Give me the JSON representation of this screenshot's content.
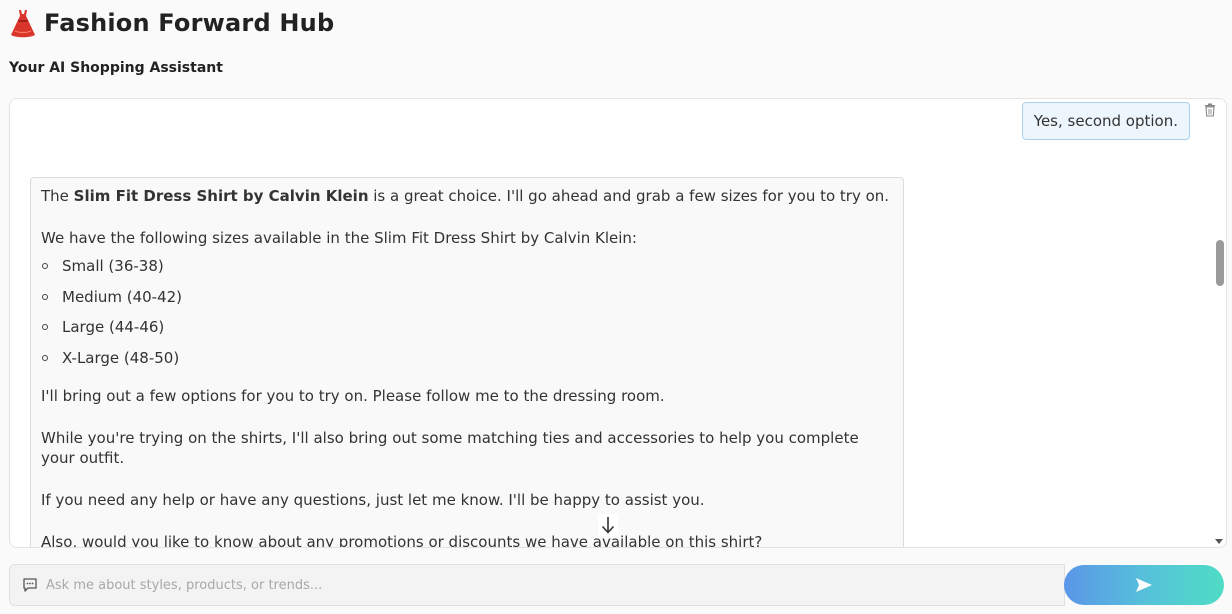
{
  "app": {
    "title": "Fashion Forward Hub",
    "subtitle": "Your AI Shopping Assistant",
    "icon": "dress-icon"
  },
  "chat": {
    "user_message": "Yes, second option.",
    "bot_message": {
      "intro_prefix": "The ",
      "intro_bold": "Slim Fit Dress Shirt by Calvin Klein",
      "intro_suffix": " is a great choice. I'll go ahead and grab a few sizes for you to try on.",
      "sizes_heading": "We have the following sizes available in the Slim Fit Dress Shirt by Calvin Klein:",
      "sizes": [
        "Small (36-38)",
        "Medium (40-42)",
        "Large (44-46)",
        "X-Large (48-50)"
      ],
      "paragraph_1": "I'll bring out a few options for you to try on. Please follow me to the dressing room.",
      "paragraph_2": "While you're trying on the shirts, I'll also bring out some matching ties and accessories to help you complete your outfit.",
      "paragraph_3": "If you need any help or have any questions, just let me know. I'll be happy to assist you.",
      "paragraph_4": "Also, would you like to know about any promotions or discounts we have available on this shirt?"
    },
    "icons": {
      "clear": "trash-icon",
      "scroll_down": "arrow-down-icon"
    }
  },
  "input": {
    "placeholder": "Ask me about styles, products, or trends...",
    "value": "",
    "icon": "chat-bubble-icon",
    "send_icon": "send-icon"
  },
  "colors": {
    "user_bubble_bg": "#eef6fd",
    "user_bubble_border": "#a8d2f0",
    "send_gradient_start": "#5b96e8",
    "send_gradient_end": "#4fdcc4",
    "dress_red": "#d9352b"
  }
}
